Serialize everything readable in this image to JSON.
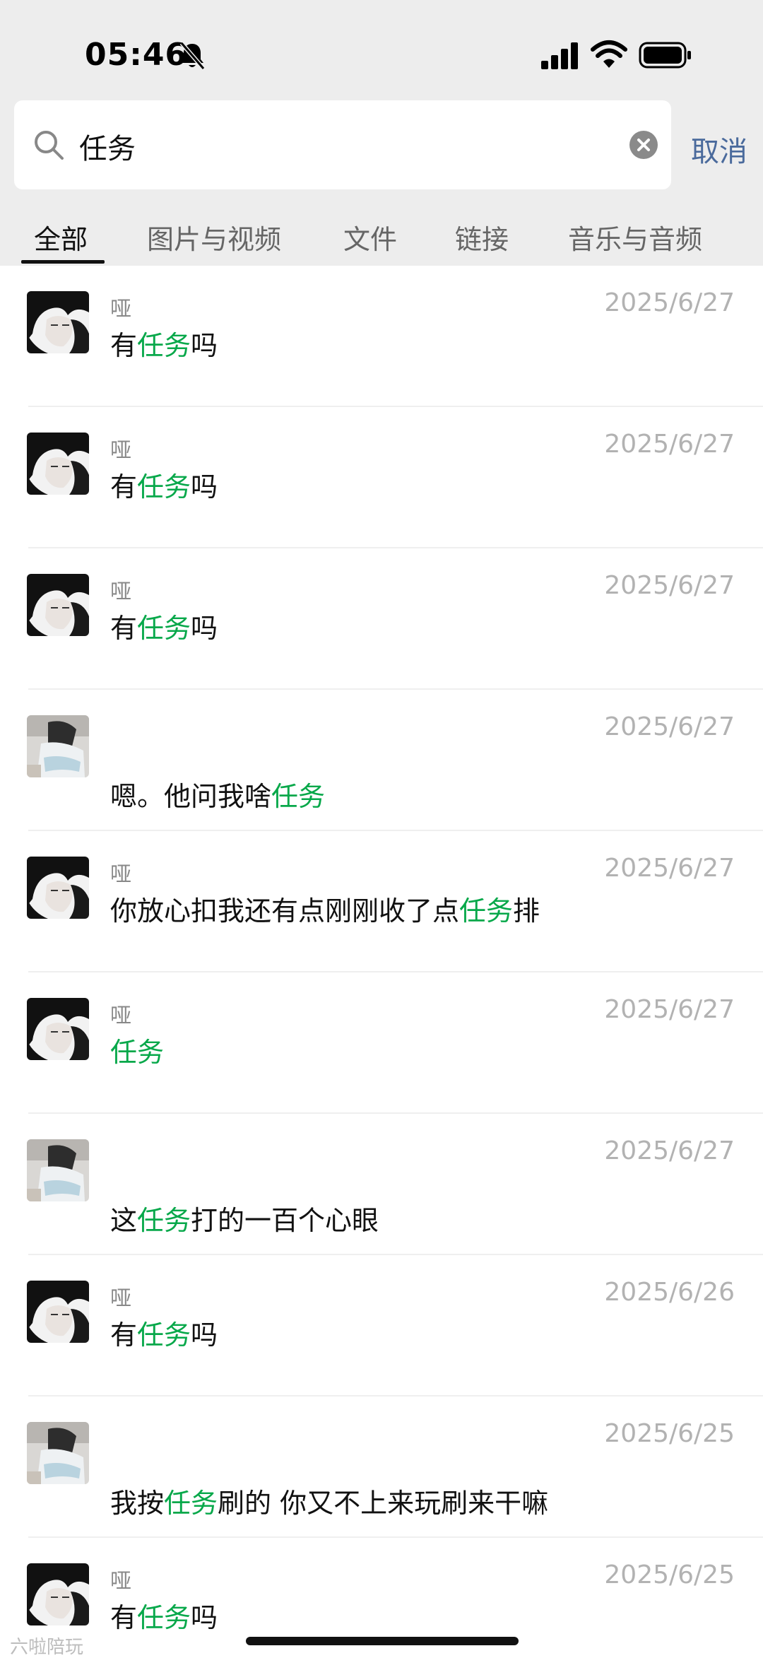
{
  "status_bar": {
    "time": "05:46",
    "icons": [
      "bell-slash-icon",
      "cellular-signal-icon",
      "wifi-icon",
      "battery-icon"
    ]
  },
  "search": {
    "query": "任务",
    "cancel_label": "取消"
  },
  "tabs": [
    {
      "label": "全部",
      "active": true
    },
    {
      "label": "图片与视频",
      "active": false
    },
    {
      "label": "文件",
      "active": false
    },
    {
      "label": "链接",
      "active": false
    },
    {
      "label": "音乐与音频",
      "active": false
    }
  ],
  "highlight_color": "#07a84a",
  "results": [
    {
      "avatar": "dark-hair-avatar",
      "sender": "哑",
      "date": "2025/6/27",
      "before": "有",
      "match": "任务",
      "after": "吗"
    },
    {
      "avatar": "dark-hair-avatar",
      "sender": "哑",
      "date": "2025/6/27",
      "before": "有",
      "match": "任务",
      "after": "吗"
    },
    {
      "avatar": "dark-hair-avatar",
      "sender": "哑",
      "date": "2025/6/27",
      "before": "有",
      "match": "任务",
      "after": "吗"
    },
    {
      "avatar": "light-photo-avatar",
      "sender": "",
      "date": "2025/6/27",
      "before": "嗯。他问我啥",
      "match": "任务",
      "after": ""
    },
    {
      "avatar": "dark-hair-avatar",
      "sender": "哑",
      "date": "2025/6/27",
      "before": "你放心扣我还有点刚刚收了点",
      "match": "任务",
      "after": "排"
    },
    {
      "avatar": "dark-hair-avatar",
      "sender": "哑",
      "date": "2025/6/27",
      "before": "",
      "match": "任务",
      "after": ""
    },
    {
      "avatar": "light-photo-avatar",
      "sender": "",
      "date": "2025/6/27",
      "before": "这",
      "match": "任务",
      "after": "打的一百个心眼"
    },
    {
      "avatar": "dark-hair-avatar",
      "sender": "哑",
      "date": "2025/6/26",
      "before": "有",
      "match": "任务",
      "after": "吗"
    },
    {
      "avatar": "light-photo-avatar",
      "sender": "",
      "date": "2025/6/25",
      "before": "我按",
      "match": "任务",
      "after": "刷的  你又不上来玩刷来干嘛"
    },
    {
      "avatar": "dark-hair-avatar",
      "sender": "哑",
      "date": "2025/6/25",
      "before": "有",
      "match": "任务",
      "after": "吗"
    }
  ],
  "watermark": "六啦陪玩"
}
